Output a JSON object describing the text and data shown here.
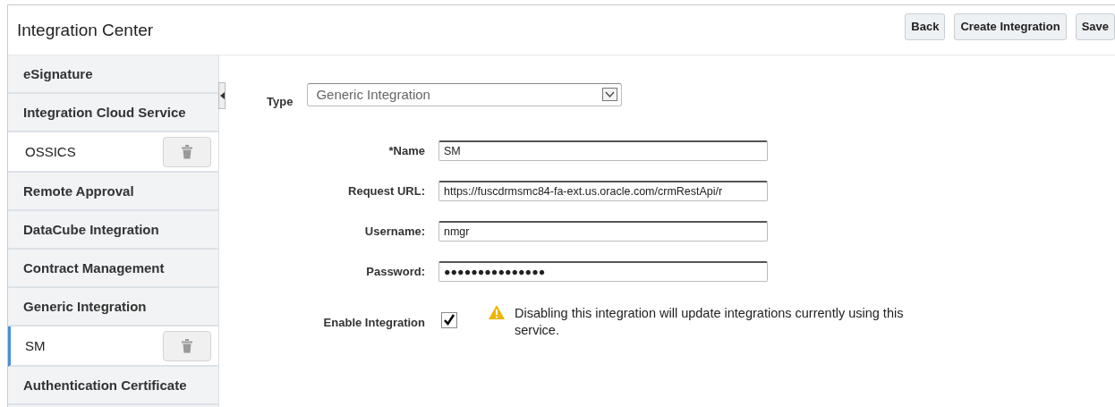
{
  "header": {
    "title": "Integration Center",
    "buttons": [
      "Back",
      "Create Integration",
      "Save"
    ]
  },
  "sidebar": {
    "items": [
      {
        "kind": "category",
        "label": "eSignature"
      },
      {
        "kind": "category",
        "label": "Integration Cloud Service"
      },
      {
        "kind": "entry",
        "label": "OSSICS",
        "selected": false
      },
      {
        "kind": "category",
        "label": "Remote Approval"
      },
      {
        "kind": "category",
        "label": "DataCube Integration"
      },
      {
        "kind": "category",
        "label": "Contract Management"
      },
      {
        "kind": "category",
        "label": "Generic Integration"
      },
      {
        "kind": "entry",
        "label": "SM",
        "selected": true
      },
      {
        "kind": "category",
        "label": "Authentication Certificate"
      }
    ]
  },
  "form": {
    "type": {
      "label": "Type",
      "value": "Generic Integration"
    },
    "fields": [
      {
        "label": "*Name",
        "value": "SM"
      },
      {
        "label": "Request URL:",
        "value": "https://fuscdrmsmc84-fa-ext.us.oracle.com/crmRestApi/r"
      },
      {
        "label": "Username:",
        "value": "nmgr"
      },
      {
        "label": "Password:",
        "value": "●●●●●●●●●●●●●●●"
      }
    ],
    "enable": {
      "label": "Enable Integration",
      "checked": true,
      "warning": "Disabling this integration will update integrations currently using this service."
    }
  }
}
